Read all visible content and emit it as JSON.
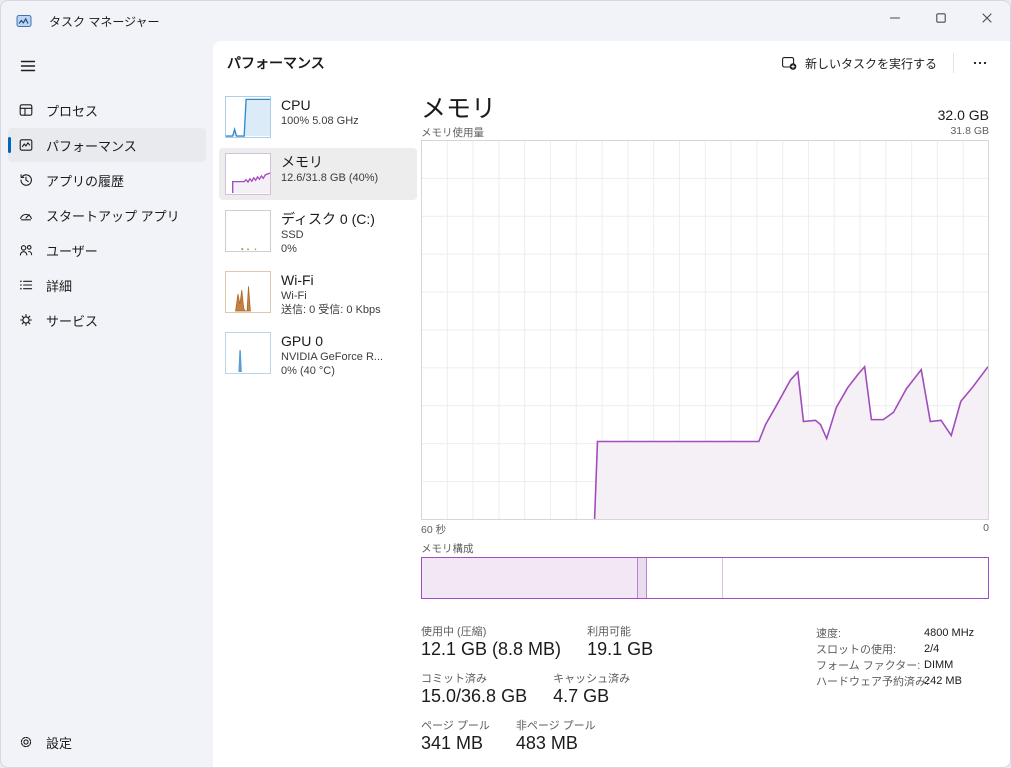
{
  "window": {
    "title": "タスク マネージャー"
  },
  "sidebar": {
    "items": [
      {
        "id": "processes",
        "label": "プロセス"
      },
      {
        "id": "performance",
        "label": "パフォーマンス",
        "selected": true
      },
      {
        "id": "app-history",
        "label": "アプリの履歴"
      },
      {
        "id": "startup-apps",
        "label": "スタートアップ アプリ"
      },
      {
        "id": "users",
        "label": "ユーザー"
      },
      {
        "id": "details",
        "label": "詳細"
      },
      {
        "id": "services",
        "label": "サービス"
      }
    ],
    "settings": {
      "label": "設定"
    }
  },
  "header": {
    "title": "パフォーマンス",
    "run_new_task_label": "新しいタスクを実行する"
  },
  "tiles": [
    {
      "name": "CPU",
      "line1": "100% 5.08 GHz"
    },
    {
      "name": "メモリ",
      "line1": "12.6/31.8 GB (40%)",
      "selected": true
    },
    {
      "name": "ディスク 0 (C:)",
      "line1": "SSD",
      "line2": "0%"
    },
    {
      "name": "Wi-Fi",
      "line1": "Wi-Fi",
      "line2": "送信: 0 受信: 0 Kbps"
    },
    {
      "name": "GPU 0",
      "line1": "NVIDIA GeForce R...",
      "line2": "0% (40 °C)"
    }
  ],
  "detail": {
    "title": "メモリ",
    "total_label": "32.0 GB",
    "usage_caption": "メモリ使用量",
    "axis_max_label": "31.8 GB",
    "x_left_label": "60 秒",
    "x_right_label": "0",
    "composition_label": "メモリ構成",
    "stats": [
      {
        "label": "使用中 (圧縮)",
        "value": "12.1 GB (8.8 MB)"
      },
      {
        "label": "利用可能",
        "value": "19.1 GB"
      },
      {
        "label": "コミット済み",
        "value": "15.0/36.8 GB"
      },
      {
        "label": "キャッシュ済み",
        "value": "4.7 GB"
      },
      {
        "label": "ページ プール",
        "value": "341 MB"
      },
      {
        "label": "非ページ プール",
        "value": "483 MB"
      }
    ],
    "hardware": [
      {
        "label": "速度:",
        "value": "4800 MHz"
      },
      {
        "label": "スロットの使用:",
        "value": "2/4"
      },
      {
        "label": "フォーム ファクター:",
        "value": "DIMM"
      },
      {
        "label": "ハードウェア予約済み:",
        "value": "242 MB"
      }
    ]
  },
  "chart_data": {
    "type": "area",
    "title": "メモリ使用量",
    "y_axis_max_gb": 31.8,
    "total_gb": 32.0,
    "x_axis": "seconds ago, 60 (left) to 0 (right)",
    "line_color": "#a24cbd",
    "fill_color": "#f4f0f5",
    "points_pct": [
      [
        30.5,
        0
      ],
      [
        31,
        20.5
      ],
      [
        59.5,
        20.5
      ],
      [
        60.7,
        25
      ],
      [
        62.5,
        29.7
      ],
      [
        65.1,
        36.8
      ],
      [
        66.4,
        38.9
      ],
      [
        67.4,
        25.8
      ],
      [
        69.5,
        26.1
      ],
      [
        70.4,
        25
      ],
      [
        71.5,
        21.3
      ],
      [
        73.2,
        29.5
      ],
      [
        75.2,
        34.7
      ],
      [
        77.1,
        38.4
      ],
      [
        78.2,
        40.3
      ],
      [
        79.4,
        26.3
      ],
      [
        81.5,
        26.3
      ],
      [
        83.3,
        28.2
      ],
      [
        85.6,
        34.5
      ],
      [
        88.2,
        39.5
      ],
      [
        89.8,
        25.8
      ],
      [
        91.7,
        26.1
      ],
      [
        93.5,
        22.1
      ],
      [
        95.2,
        31.1
      ],
      [
        97.2,
        34.7
      ],
      [
        100,
        40.3
      ]
    ],
    "composition_segments": [
      {
        "name": "in-use",
        "pct": 38.2
      },
      {
        "name": "modified",
        "pct": 1.6
      },
      {
        "name": "standby",
        "pct": 13.4
      },
      {
        "name": "free",
        "pct": 46.8
      }
    ]
  }
}
